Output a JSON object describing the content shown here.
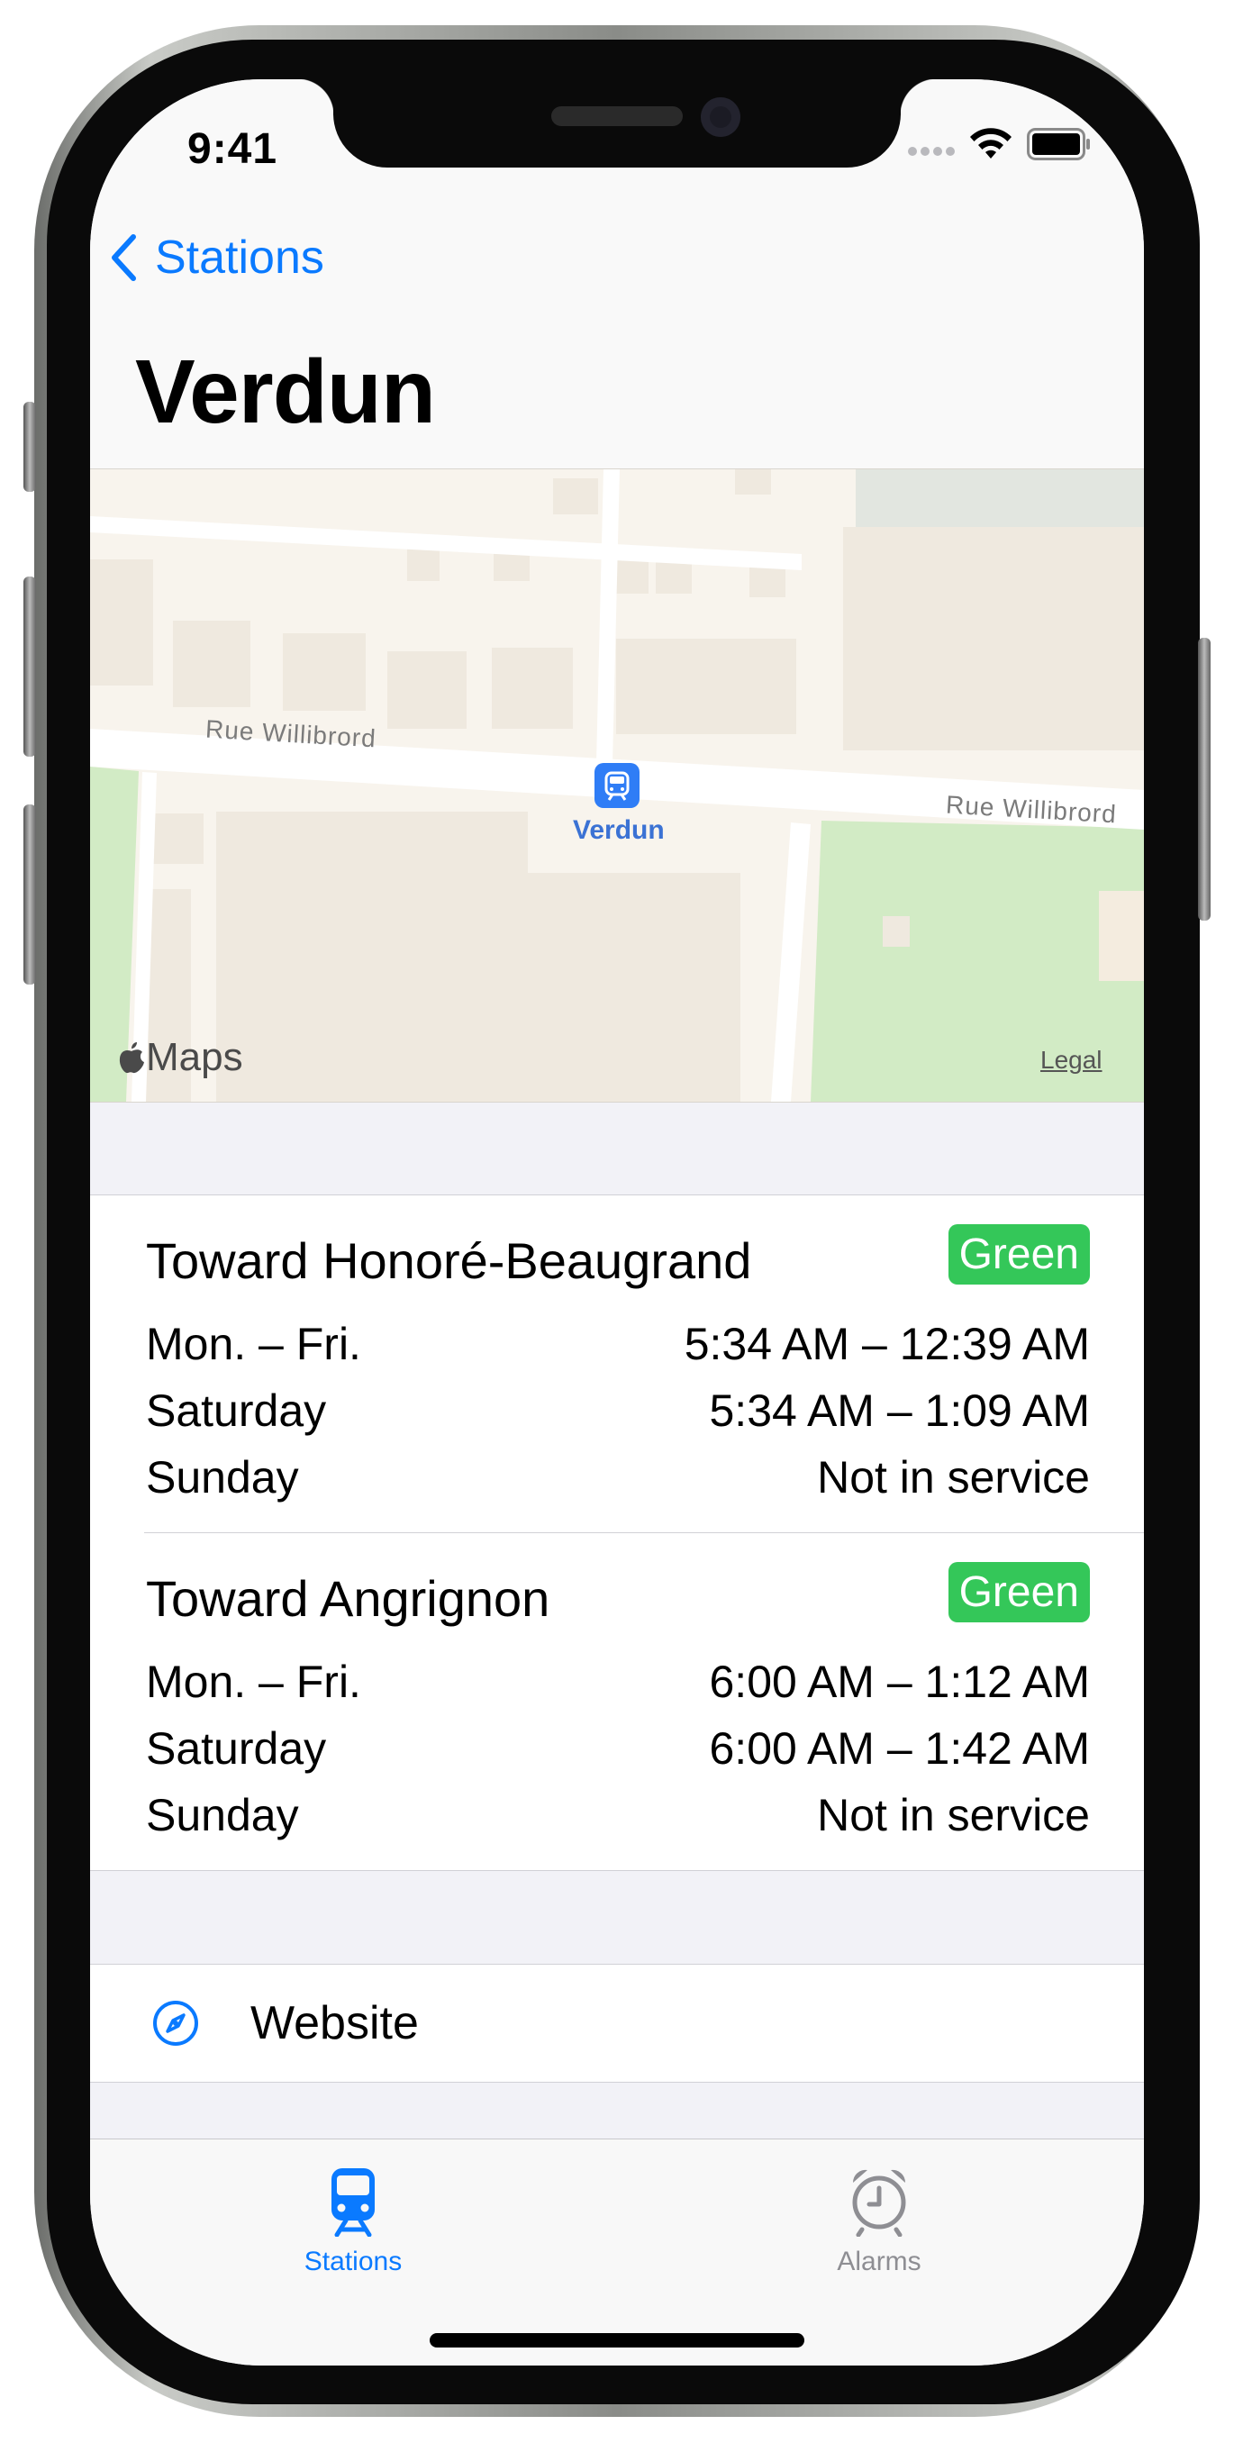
{
  "status_bar": {
    "time": "9:41"
  },
  "nav": {
    "back_label": "Stations",
    "title": "Verdun"
  },
  "map": {
    "street_left": "Rue Willibrord",
    "street_right": "Rue Willibrord",
    "station_label": "Verdun",
    "logo_text": "Maps",
    "legal": "Legal"
  },
  "schedules": [
    {
      "direction": "Toward Honoré-Beaugrand",
      "line": "Green",
      "rows": [
        {
          "day": "Mon. – Fri.",
          "hours": "5:34 AM – 12:39 AM"
        },
        {
          "day": "Saturday",
          "hours": "5:34 AM – 1:09 AM"
        },
        {
          "day": "Sunday",
          "hours": "Not in service"
        }
      ]
    },
    {
      "direction": "Toward Angrignon",
      "line": "Green",
      "rows": [
        {
          "day": "Mon. – Fri.",
          "hours": "6:00 AM – 1:12 AM"
        },
        {
          "day": "Saturday",
          "hours": "6:00 AM – 1:42 AM"
        },
        {
          "day": "Sunday",
          "hours": "Not in service"
        }
      ]
    }
  ],
  "links": {
    "website_label": "Website"
  },
  "tabbar": {
    "tabs": [
      {
        "label": "Stations",
        "icon": "tram-icon",
        "selected": true
      },
      {
        "label": "Alarms",
        "icon": "alarm-clock-icon",
        "selected": false
      }
    ]
  },
  "colors": {
    "accent": "#0a7aff",
    "green_line": "#34c759",
    "inactive_tab": "#8e8e93"
  }
}
